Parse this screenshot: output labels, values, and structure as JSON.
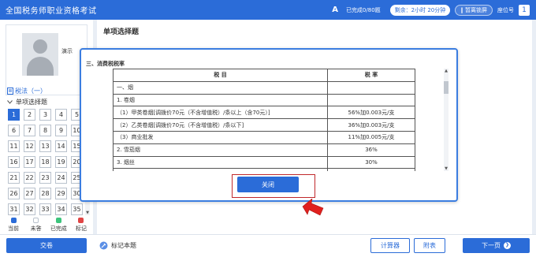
{
  "header": {
    "title": "全国税务师职业资格考试",
    "font_icon_label": "A",
    "progress": "已完成0/80题",
    "time_remaining": "剩余：2小时 20分钟",
    "exit_label": "‖ 暂离锁屏",
    "seat_label": "座位号",
    "seat_number": "1"
  },
  "sidebar": {
    "username": "演示",
    "subject": "税法（一）",
    "section": "单项选择题",
    "questions": [
      "1",
      "2",
      "3",
      "4",
      "5",
      "6",
      "7",
      "8",
      "9",
      "10",
      "11",
      "12",
      "13",
      "14",
      "15",
      "16",
      "17",
      "18",
      "19",
      "20",
      "21",
      "22",
      "23",
      "24",
      "25",
      "26",
      "27",
      "28",
      "29",
      "30",
      "31",
      "32",
      "33",
      "34",
      "35"
    ],
    "current_question": "1",
    "legend": [
      {
        "label": "当前",
        "color": "#2b6cd8"
      },
      {
        "label": "未答",
        "color": "#ffffff"
      },
      {
        "label": "已完成",
        "color": "#3cc47c"
      },
      {
        "label": "标记",
        "color": "#e04545"
      }
    ]
  },
  "main": {
    "heading": "单项选择题"
  },
  "modal": {
    "title": "三、消费税税率",
    "columns": [
      "税 目",
      "税 率"
    ],
    "rows": [
      [
        "一、烟",
        ""
      ],
      [
        "1. 卷烟",
        ""
      ],
      [
        "（1）甲类卷烟[调拨价70元（不含增值税）/条以上（含70元）]",
        "56%加0.003元/支"
      ],
      [
        "（2）乙类卷烟[调拨价70元（不含增值税）/条以下]",
        "36%加0.003元/支"
      ],
      [
        "（3）商业批发",
        "11%加0.005元/支"
      ],
      [
        "2. 雪茄烟",
        "36%"
      ],
      [
        "3. 烟丝",
        "30%"
      ],
      [
        "",
        ""
      ]
    ],
    "close_label": "关闭"
  },
  "footer": {
    "submit_label": "交卷",
    "mark_label": "标记本题",
    "calculator_label": "计算器",
    "appendix_label": "附表",
    "next_label": "下一页"
  },
  "colors": {
    "primary": "#2b6cd8",
    "highlight_border": "#c0282b",
    "pointer": "#e0201e"
  }
}
